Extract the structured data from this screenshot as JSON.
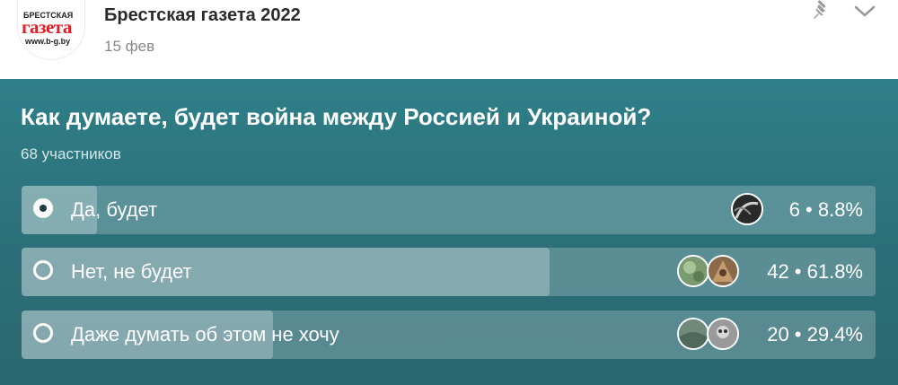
{
  "header": {
    "channel_name": "Брестская газета 2022",
    "date": "15 фев",
    "logo": {
      "top": "БРЕСТСКАЯ",
      "main": "газета",
      "site": "www.b-g.by"
    },
    "icons": [
      "pin-icon",
      "chevron-down-icon"
    ]
  },
  "poll": {
    "question": "Как думаете, будет война между Россией и Украиной?",
    "participants": "68 участников",
    "options": [
      {
        "label": "Да, будет",
        "count": "6",
        "percent": "8.8%",
        "stats": "6 • 8.8%",
        "fraction": 0.088,
        "selected": true
      },
      {
        "label": "Нет, не будет",
        "count": "42",
        "percent": "61.8%",
        "stats": "42 • 61.8%",
        "fraction": 0.618,
        "selected": false
      },
      {
        "label": "Даже думать об этом не хочу",
        "count": "20",
        "percent": "29.4%",
        "stats": "20 • 29.4%",
        "fraction": 0.294,
        "selected": false
      }
    ]
  },
  "colors": {
    "poll_bg": "#2c6f78",
    "accent_red": "#e31e24",
    "text_white": "#ffffff"
  }
}
